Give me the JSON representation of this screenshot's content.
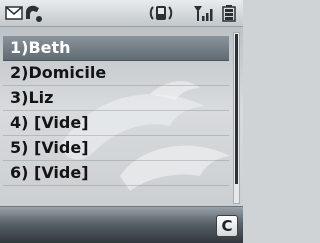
{
  "status_bar": {
    "icons": [
      "messages-icon",
      "call-status-icon",
      "vibrate-ring-icon",
      "signal-strength-icon",
      "battery-icon"
    ]
  },
  "list": {
    "selected_index": 0,
    "items": [
      {
        "label": "1)Beth"
      },
      {
        "label": "2)Domicile"
      },
      {
        "label": "3)Liz"
      },
      {
        "label": "4) [Vide]"
      },
      {
        "label": "5) [Vide]"
      },
      {
        "label": "6) [Vide]"
      }
    ]
  },
  "softkeys": {
    "clear_label": "C"
  },
  "colors": {
    "selection": "#6b757d",
    "text": "#141414",
    "softkey_bar": "#3a4045"
  }
}
